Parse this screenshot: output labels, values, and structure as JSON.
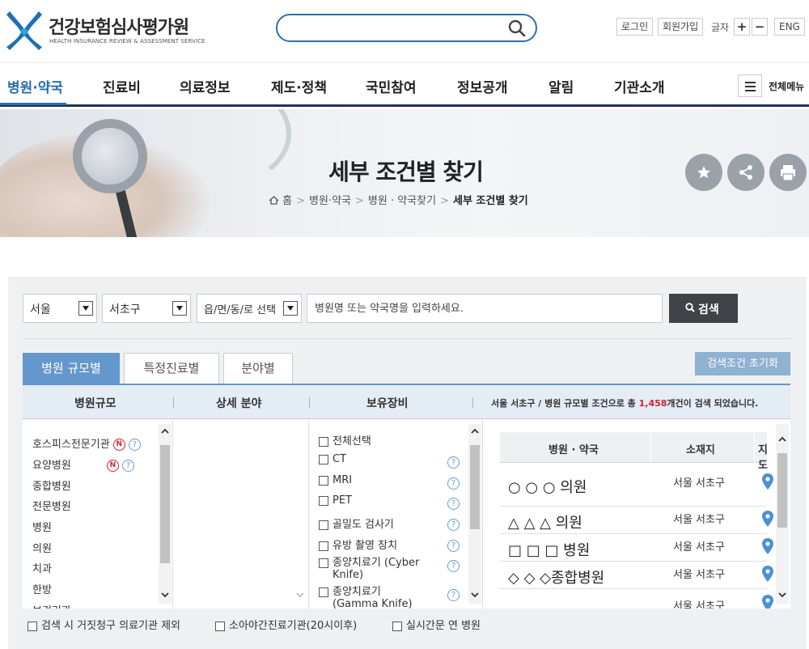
{
  "header": {
    "logo_name": "건강보험심사평가원",
    "logo_sub": "HEALTH INSURANCE REVIEW & ASSESSMENT SERVICE",
    "search_placeholder": "",
    "login": "로그인",
    "signup": "회원가입",
    "font_label": "글자",
    "font_plus": "+",
    "font_minus": "−",
    "lang": "ENG"
  },
  "gnb": {
    "items": [
      "병원·약국",
      "진료비",
      "의료정보",
      "제도·정책",
      "국민참여",
      "정보공개",
      "알림",
      "기관소개"
    ],
    "all_menu": "전체메뉴"
  },
  "visual": {
    "title": "세부 조건별 찾기",
    "breadcrumb": [
      "홈",
      "병원·약국",
      "병원 · 약국찾기",
      "세부 조건별 찾기"
    ]
  },
  "search": {
    "sido": "서울",
    "sigungu": "서초구",
    "dong": "읍/면/동/로 선택",
    "keyword_placeholder": "병원명 또는 약국명을 입력하세요.",
    "button": "검색"
  },
  "tabs": [
    "병원 규모별",
    "특정진료별",
    "분야별"
  ],
  "reset_button": "검색조건 초기화",
  "columns": {
    "scale": "병원규모",
    "detail": "상세 분야",
    "equipment": "보유장비"
  },
  "result_msg": {
    "prefix": "서울 서초구 / 병원 규모별 조건으로 총 ",
    "count": "1,458",
    "suffix": "개건이 검색 되었습니다."
  },
  "scale_items": [
    {
      "label": "호스피스전문기관",
      "new": "N",
      "help": "?"
    },
    {
      "label": "요양병원",
      "new": "N",
      "help": "?"
    },
    {
      "label": "종합병원"
    },
    {
      "label": "전문병원"
    },
    {
      "label": "병원"
    },
    {
      "label": "의원"
    },
    {
      "label": "치과"
    },
    {
      "label": "한방"
    },
    {
      "label": "보건기관"
    }
  ],
  "equipment_items": [
    {
      "label": "전체선택"
    },
    {
      "label": "CT",
      "help": "?"
    },
    {
      "label": "MRI",
      "help": "?"
    },
    {
      "label": "PET",
      "help": "?"
    },
    {
      "label": "골밀도 검사기",
      "help": "?"
    },
    {
      "label": "유방 촬영 장치",
      "help": "?"
    },
    {
      "label": "종양치료기 (Cyber",
      "label2": "Knife)",
      "help": "?"
    },
    {
      "label": "종양치료기",
      "label2": "(Gamma Knife)",
      "help": "?"
    }
  ],
  "results": {
    "headers": [
      "병원 · 약국",
      "소재지",
      "지도"
    ],
    "rows": [
      {
        "name": "○ ○ ○ 의원",
        "location": "서울 서초구"
      },
      {
        "name": "△ △ △ 의원",
        "location": "서울 서초구"
      },
      {
        "name": "□ □ □ 병원",
        "location": "서울 서초구"
      },
      {
        "name": "◇ ◇ ◇종합병원",
        "location": "서울 서초구"
      },
      {
        "name": "",
        "location": "서울 서초구"
      }
    ]
  },
  "options": [
    "검색 시 거짓청구 의료기관 제외",
    "소아야간진료기관(20시이후)",
    "실시간문 연 병원"
  ],
  "colors": {
    "accent": "#2a6cb0",
    "tab_active": "#6497cb",
    "nav_border": "#1f3552",
    "count_red": "#d3212d",
    "pin_blue": "#4a8fd8"
  }
}
